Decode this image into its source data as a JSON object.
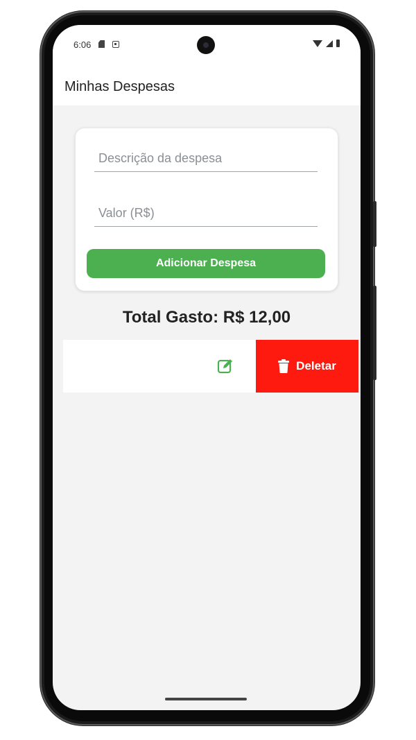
{
  "status_bar": {
    "time": "6:06",
    "left_icons": [
      "sd-card-icon",
      "notification-a-icon"
    ],
    "right_icons": [
      "wifi-icon",
      "signal-icon",
      "battery-icon"
    ]
  },
  "app_bar": {
    "title": "Minhas Despesas"
  },
  "form": {
    "description_placeholder": "Descrição da despesa",
    "description_value": "",
    "value_placeholder": "Valor (R$)",
    "value_value": "",
    "add_button_label": "Adicionar Despesa"
  },
  "summary": {
    "total_text": "Total Gasto: R$ 12,00"
  },
  "expense_list": {
    "items": [
      {
        "edit_icon": "edit-icon",
        "delete_label": "Deletar",
        "delete_icon": "trash-icon"
      }
    ]
  },
  "colors": {
    "primary_green": "#4caf50",
    "delete_red": "#ff1a10",
    "background": "#f3f3f3",
    "card": "#ffffff"
  }
}
